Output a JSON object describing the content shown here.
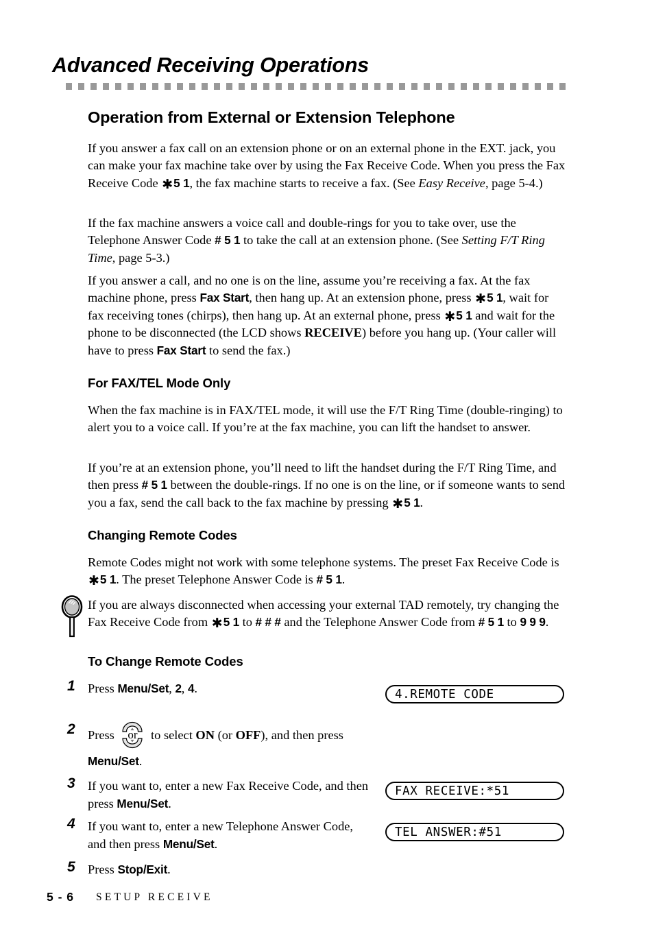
{
  "chapter": {
    "title": "Advanced Receiving Operations"
  },
  "sections": {
    "operation_heading": "Operation from External or Extension Telephone",
    "fax_tel_heading": "For FAX/TEL Mode Only",
    "changing_codes_heading": "Changing Remote Codes",
    "to_change_heading": "To Change Remote Codes"
  },
  "paragraphs": {
    "p1_a": "If you answer a fax call on an extension phone or on an external phone in the EXT. jack, you can make your fax machine take over by using the Fax Receive Code. When you press the Fax Receive Code ",
    "p1_code": "5 1",
    "p1_b": ", the fax machine starts to receive a fax. (See ",
    "p1_italic": "Easy Receive",
    "p1_c": ", page 5-4.)",
    "p2_a": "If the fax machine answers a voice call and double-rings for you to take over, use the Telephone Answer Code ",
    "p2_code": "# 5 1",
    "p2_b": " to take the call at an extension phone. (See ",
    "p2_italic": "Setting F/T Ring Time",
    "p2_c": ", page 5-3.)",
    "p3_a": "If you answer a call, and no one is on the line, assume you’re receiving a fax. At the fax machine phone, press ",
    "p3_b1": "Fax Start",
    "p3_b": ", then hang up. At an extension phone, press ",
    "p3_code1": "5 1",
    "p3_c": ", wait for fax receiving tones (chirps), then hang up.  At an external phone, press ",
    "p3_code2": "5 1",
    "p3_d": " and wait for the phone to be disconnected (the LCD shows ",
    "p3_receive": "RECEIVE",
    "p3_e": ") before you hang up. (Your caller will have to press ",
    "p3_b2": "Fax Start",
    "p3_f": " to send the fax.)",
    "p4": "When the fax machine is in FAX/TEL mode, it will use the F/T Ring Time (double-ringing) to alert you to a voice call. If you’re at the fax machine, you can lift the handset to answer.",
    "p5_a": "If you’re at an extension phone, you’ll need to lift the handset during the F/T Ring Time, and then press ",
    "p5_code1": "# 5 1",
    "p5_b": " between the double-rings. If no one is on the line, or if someone wants to send you a fax, send the call back to the fax machine by pressing ",
    "p5_code2": "5 1",
    "p5_c": ".",
    "p6_a": "Remote Codes might not work with some telephone systems. The preset Fax Receive Code is ",
    "p6_code1": "5 1",
    "p6_b": ". The preset Telephone Answer Code is ",
    "p6_code2": "# 5 1",
    "p6_c": ".",
    "tip_a": "If you are always disconnected when accessing your external TAD remotely, try changing the Fax Receive Code from ",
    "tip_code1": "5 1",
    "tip_b": " to ",
    "tip_code2": "# # #",
    "tip_c": " and the Telephone Answer Code from ",
    "tip_code3": "# 5 1",
    "tip_d": " to ",
    "tip_code4": "9 9 9",
    "tip_e": "."
  },
  "steps": [
    {
      "number": "1",
      "text_a": "Press ",
      "bold1": "Menu/Set",
      "text_b": ", ",
      "bold2": "2",
      "text_c": ", ",
      "bold3": "4",
      "text_d": "."
    },
    {
      "number": "2",
      "text_a": "Press ",
      "key_label": "or",
      "text_b": " to select ",
      "bold1": "ON",
      "text_c": " (or ",
      "bold2": "OFF",
      "text_d": "), and then press ",
      "bold3": "Menu/Set",
      "text_e": "."
    },
    {
      "number": "3",
      "text_a": "If you want to, enter a new Fax Receive Code, and then press ",
      "bold1": "Menu/Set",
      "text_b": "."
    },
    {
      "number": "4",
      "text_a": "If you want to, enter a new Telephone Answer Code, and then press ",
      "bold1": "Menu/Set",
      "text_b": "."
    },
    {
      "number": "5",
      "text_a": "Press ",
      "bold1": "Stop/Exit",
      "text_b": "."
    }
  ],
  "lcd_displays": [
    {
      "text": "4.REMOTE CODE"
    },
    {
      "text": "FAX RECEIVE:*51"
    },
    {
      "text": "TEL ANSWER:#51"
    }
  ],
  "footer": {
    "page_number": "5 - 6",
    "chapter_name": "SETUP RECEIVE"
  },
  "colors": {
    "rule_gray": "#999999",
    "text_black": "#000000",
    "bulb_gray": "#bfbfbf"
  }
}
